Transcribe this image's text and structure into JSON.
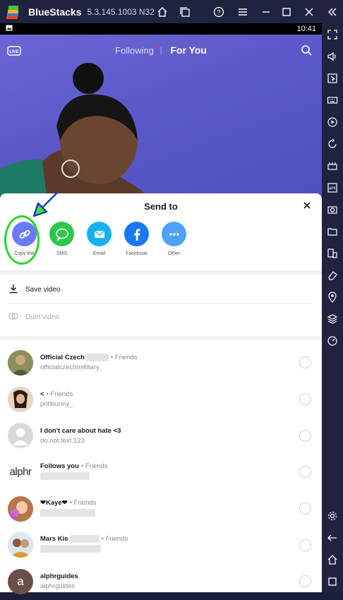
{
  "window": {
    "app_name": "BlueStacks",
    "version": "5.3.145.1003 N32"
  },
  "status_bar": {
    "time": "10:41"
  },
  "feed_nav": {
    "following": "Following",
    "for_you": "For You"
  },
  "sheet": {
    "title": "Send to",
    "share_targets": [
      {
        "label": "Copy link",
        "icon": "link-icon",
        "color": "#6b7bff"
      },
      {
        "label": "SMS",
        "icon": "sms-icon",
        "color": "#2cc84b"
      },
      {
        "label": "Email",
        "icon": "email-icon",
        "color": "#17b1f0"
      },
      {
        "label": "Facebook",
        "icon": "facebook-icon",
        "color": "#1877f2"
      },
      {
        "label": "Other",
        "icon": "more-icon",
        "color": "#4ea2f7"
      }
    ],
    "actions": [
      {
        "label": "Save video",
        "icon": "download-icon"
      },
      {
        "label": "Duet video",
        "icon": "duet-icon"
      }
    ],
    "friends": [
      {
        "name": "Official Czech",
        "tag": "• Friends",
        "handle": "officialczechmillitary"
      },
      {
        "name": "<",
        "tag": "• Friends",
        "handle": "pritibunny_"
      },
      {
        "name": "I don't care about hate <3",
        "tag": "",
        "handle": "do.not.text.123"
      },
      {
        "name": "Follows you",
        "tag": "• Friends",
        "handle": ""
      },
      {
        "name": "❤Kaye❤",
        "tag": "• Friends",
        "handle": ""
      },
      {
        "name": "Mars Kie",
        "tag": "• Friends",
        "handle": ""
      },
      {
        "name": "alphrguides",
        "tag": "",
        "handle": "alphrguides"
      }
    ],
    "alphr_avatar_text": "alphr",
    "alphrguides_avatar_letter": "a"
  },
  "colors": {
    "accent_green": "#2bd62b",
    "titlebar": "#1f2340"
  }
}
